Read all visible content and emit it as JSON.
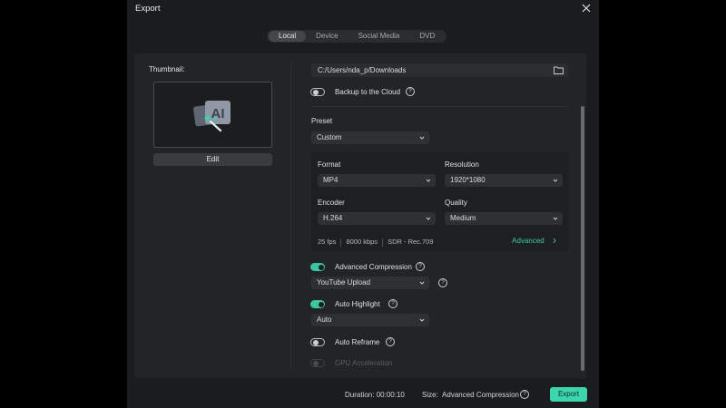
{
  "dialog": {
    "title": "Export"
  },
  "tabs": [
    {
      "label": "Local",
      "active": true
    },
    {
      "label": "Device",
      "active": false
    },
    {
      "label": "Social Media",
      "active": false
    },
    {
      "label": "DVD",
      "active": false
    }
  ],
  "thumbnail": {
    "label": "Thumbnail:",
    "edit_label": "Edit",
    "image_text": "AI"
  },
  "save_path": {
    "value": "C:/Users/nda_p/Downloads"
  },
  "backup": {
    "label": "Backup to the Cloud",
    "enabled": false
  },
  "preset": {
    "label": "Preset",
    "value": "Custom"
  },
  "format": {
    "label": "Format",
    "value": "MP4"
  },
  "resolution": {
    "label": "Resolution",
    "value": "1920*1080"
  },
  "encoder": {
    "label": "Encoder",
    "value": "H.264"
  },
  "quality": {
    "label": "Quality",
    "value": "Medium"
  },
  "summary": {
    "fps": "25 fps",
    "bitrate": "8000 kbps",
    "color": "SDR - Rec.709",
    "advanced_label": "Advanced"
  },
  "advanced_compression": {
    "label": "Advanced Compression",
    "enabled": true,
    "value": "YouTube Upload"
  },
  "auto_highlight": {
    "label": "Auto Highlight",
    "enabled": true,
    "value": "Auto"
  },
  "auto_reframe": {
    "label": "Auto Reframe",
    "enabled": false
  },
  "gpu_acceleration": {
    "label": "GPU Acceleration",
    "enabled": false,
    "disabled": true
  },
  "footer": {
    "duration_label": "Duration:",
    "duration_value": "00:00:10",
    "size_label": "Size:",
    "size_value": "Advanced Compression",
    "export_label": "Export"
  },
  "colors": {
    "accent": "#3cc7a2",
    "button_accent": "#3cd6ae",
    "dialog_bg": "#1b1c1e",
    "panel_bg": "#232427"
  },
  "icons": {
    "close": "close-icon",
    "folder": "folder-icon",
    "help": "help-icon",
    "chevron": "chevron-down-icon"
  }
}
